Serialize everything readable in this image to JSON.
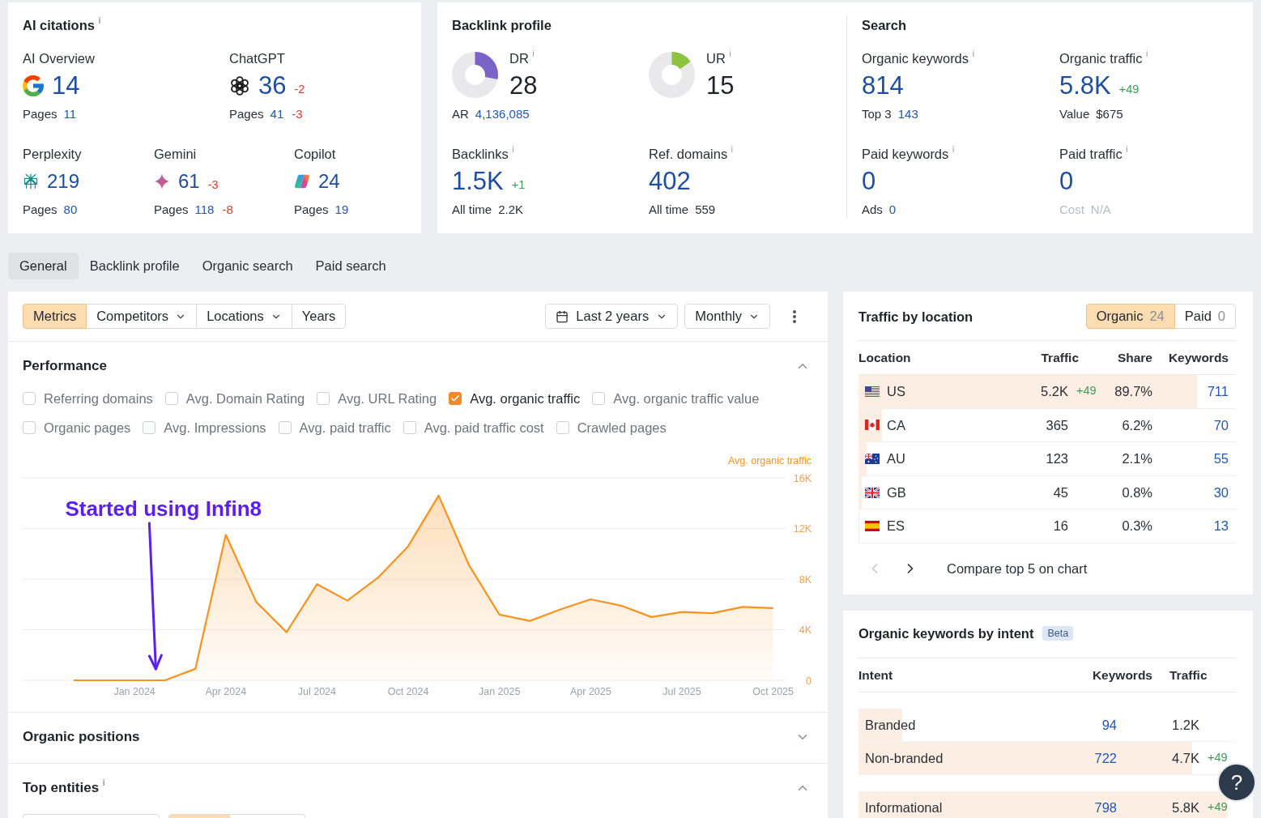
{
  "ai_citations": {
    "title": "AI citations $^{i}$",
    "rows": [
      {
        "items": [
          {
            "label": "AI Overview",
            "kind": "google",
            "value": "14",
            "sub": {
              "label": "Pages",
              "value": "11",
              "link": true
            }
          },
          {
            "label": "ChatGPT",
            "kind": "chatgpt",
            "value": "36",
            "change": {
              "text": "-2",
              "negative": true
            },
            "sub": {
              "label": "Pages",
              "value": "41",
              "link": true,
              "change": {
                "text": "-3",
                "negative": true
              }
            }
          }
        ]
      },
      {
        "items": [
          {
            "label": "Perplexity",
            "kind": "perplexity",
            "value": "219",
            "sub": {
              "label": "Pages",
              "value": "80",
              "link": true
            }
          },
          {
            "label": "Gemini",
            "kind": "gemini",
            "value": "61",
            "change": {
              "text": "-3",
              "negative": true
            },
            "sub": {
              "label": "Pages",
              "value": "118",
              "link": true,
              "change": {
                "text": "-8",
                "negative": true
              }
            }
          },
          {
            "label": "Copilot",
            "kind": "copilot",
            "value": "24",
            "sub": {
              "label": "Pages",
              "value": "19",
              "link": true
            }
          }
        ]
      }
    ]
  },
  "backlink_profile": {
    "title": "Backlink profile",
    "ratings": [
      {
        "label": "DR $^{i}$",
        "value": "28",
        "level": 0.28,
        "color": "#7b64c7",
        "sub": {
          "label": "AR",
          "value": "4,136,085",
          "link": true
        }
      },
      {
        "label": "UR $^{i}$",
        "value": "15",
        "level": 0.15,
        "color": "#8cc43f"
      }
    ],
    "stats": [
      {
        "label": "Backlinks $^{i}$",
        "value": "1.5K",
        "change": {
          "text": "+1",
          "negative": false
        },
        "sub": {
          "label": "All time",
          "value": "2.2K",
          "link": false
        }
      },
      {
        "label": "Ref. domains $^{i}$",
        "value": "402",
        "sub": {
          "label": "All time",
          "value": "559",
          "link": false
        }
      }
    ]
  },
  "search": {
    "title": "Search",
    "stats": [
      {
        "label": "Organic keywords $^{i}$",
        "value": "814",
        "sub": {
          "label": "Top 3",
          "value": "143",
          "link": true,
          "disabled": false
        }
      },
      {
        "label": "Organic traffic $^{i}$",
        "value": "5.8K",
        "change": {
          "text": "+49",
          "negative": false
        },
        "sub": {
          "label": "Value",
          "value": "$675",
          "link": false,
          "disabled": false
        }
      },
      {
        "label": "Paid keywords $^{i}$",
        "value": "0",
        "sub": {
          "label": "Ads",
          "value": "0",
          "link": true,
          "disabled": false
        }
      },
      {
        "label": "Paid traffic $^{i}$",
        "value": "0",
        "sub": {
          "label": "Cost",
          "value": "N/A",
          "link": false,
          "disabled": true
        }
      }
    ]
  },
  "tabs": [
    {
      "label": "General",
      "selected": true
    },
    {
      "label": "Backlink profile",
      "selected": false
    },
    {
      "label": "Organic search",
      "selected": false
    },
    {
      "label": "Paid search",
      "selected": false
    }
  ],
  "main_panel": {
    "toolbar": {
      "filters": [
        {
          "label": "Metrics",
          "selected": true,
          "dropdown": false
        },
        {
          "label": "Competitors",
          "selected": false,
          "dropdown": true
        },
        {
          "label": "Locations",
          "selected": false,
          "dropdown": true
        },
        {
          "label": "Years",
          "selected": false,
          "dropdown": false
        }
      ],
      "period": "Last 2 years",
      "interval": "Monthly"
    },
    "performance": {
      "title": "Performance",
      "expanded": true,
      "metric_rows": [
        {
          "metrics": [
            {
              "label": "Referring domains",
              "checked": false
            },
            {
              "label": "Avg. Domain Rating",
              "checked": false
            },
            {
              "label": "Avg. URL Rating",
              "checked": false
            },
            {
              "label": "Avg. organic traffic",
              "checked": true
            },
            {
              "label": "Avg. organic traffic value",
              "checked": false
            }
          ]
        },
        {
          "metrics": [
            {
              "label": "Organic pages",
              "checked": false
            },
            {
              "label": "Avg. Impressions",
              "checked": false
            },
            {
              "label": "Avg. paid traffic",
              "checked": false
            },
            {
              "label": "Avg. paid traffic cost",
              "checked": false
            },
            {
              "label": "Crawled pages",
              "checked": false
            }
          ]
        }
      ],
      "chart_data": {
        "type": "area",
        "categories": [
          null,
          null,
          "Jan 2024",
          null,
          null,
          "Apr 2024",
          null,
          null,
          "Jul 2024",
          null,
          null,
          "Oct 2024",
          null,
          null,
          "Jan 2025",
          null,
          null,
          "Apr 2025",
          null,
          null,
          "Jul 2025",
          null,
          null,
          "Oct 2025"
        ],
        "series": [
          {
            "name": "Avg. organic traffic",
            "color": "#f7931e",
            "values": [
              0,
              0,
              0,
              0,
              900,
              11500,
              6200,
              3800,
              7600,
              6300,
              8100,
              10600,
              14600,
              9100,
              5200,
              4700,
              5600,
              6400,
              5900,
              5000,
              5400,
              5300,
              5800,
              5700
            ]
          }
        ],
        "ylim": [
          0,
          16000
        ],
        "yticks": [
          {
            "value": 0,
            "label": "0"
          },
          {
            "value": 4000,
            "label": "4K"
          },
          {
            "value": 8000,
            "label": "8K"
          },
          {
            "value": 12000,
            "label": "12K"
          },
          {
            "value": 16000,
            "label": "16K"
          }
        ],
        "grid": true,
        "annotations": [
          "Started using Infin8"
        ]
      }
    },
    "sections": [
      {
        "title": "Organic positions",
        "expanded": false
      },
      {
        "title": "Top entities $^{i}$",
        "expanded": true
      }
    ]
  },
  "traffic_by_location": {
    "title": "Traffic by location",
    "toggle": [
      {
        "label": "Organic",
        "count": "24",
        "selected": true
      },
      {
        "label": "Paid",
        "count": "0",
        "selected": false
      }
    ],
    "columns": [
      "Location",
      "Traffic",
      "Share",
      "Keywords"
    ],
    "rows": [
      {
        "kind": "us",
        "code": "US",
        "traffic": "5.2K",
        "change": {
          "text": "+49",
          "negative": false
        },
        "share": "89.7%",
        "level": 0.897,
        "keywords": "711"
      },
      {
        "kind": "ca",
        "code": "CA",
        "traffic": "365",
        "share": "6.2%",
        "level": 0.062,
        "keywords": "70"
      },
      {
        "kind": "au",
        "code": "AU",
        "traffic": "123",
        "share": "2.1%",
        "level": 0.021,
        "keywords": "55"
      },
      {
        "kind": "gb",
        "code": "GB",
        "traffic": "45",
        "share": "0.8%",
        "level": 0.008,
        "keywords": "30"
      },
      {
        "kind": "es",
        "code": "ES",
        "traffic": "16",
        "share": "0.3%",
        "level": 0.003,
        "keywords": "13"
      }
    ],
    "pager": {
      "prev_disabled": true,
      "next_disabled": false,
      "action": "Compare top 5 on chart"
    }
  },
  "keywords_by_intent": {
    "title": "Organic keywords by intent",
    "badge": "Beta",
    "columns": [
      "Intent",
      "Keywords",
      "Traffic"
    ],
    "groups": [
      {
        "rows": [
          {
            "label": "Branded",
            "keywords": "94",
            "traffic": "1.2K",
            "level": 0.115
          },
          {
            "label": "Non-branded",
            "keywords": "722",
            "traffic": "4.7K",
            "change": {
              "text": "+49",
              "negative": false
            },
            "level": 0.885
          }
        ]
      },
      {
        "rows": [
          {
            "label": "Informational",
            "keywords": "798",
            "traffic": "5.8K",
            "change": {
              "text": "+49",
              "negative": false
            },
            "level": 0.978
          }
        ]
      }
    ]
  },
  "help_button": {
    "label": "?"
  }
}
